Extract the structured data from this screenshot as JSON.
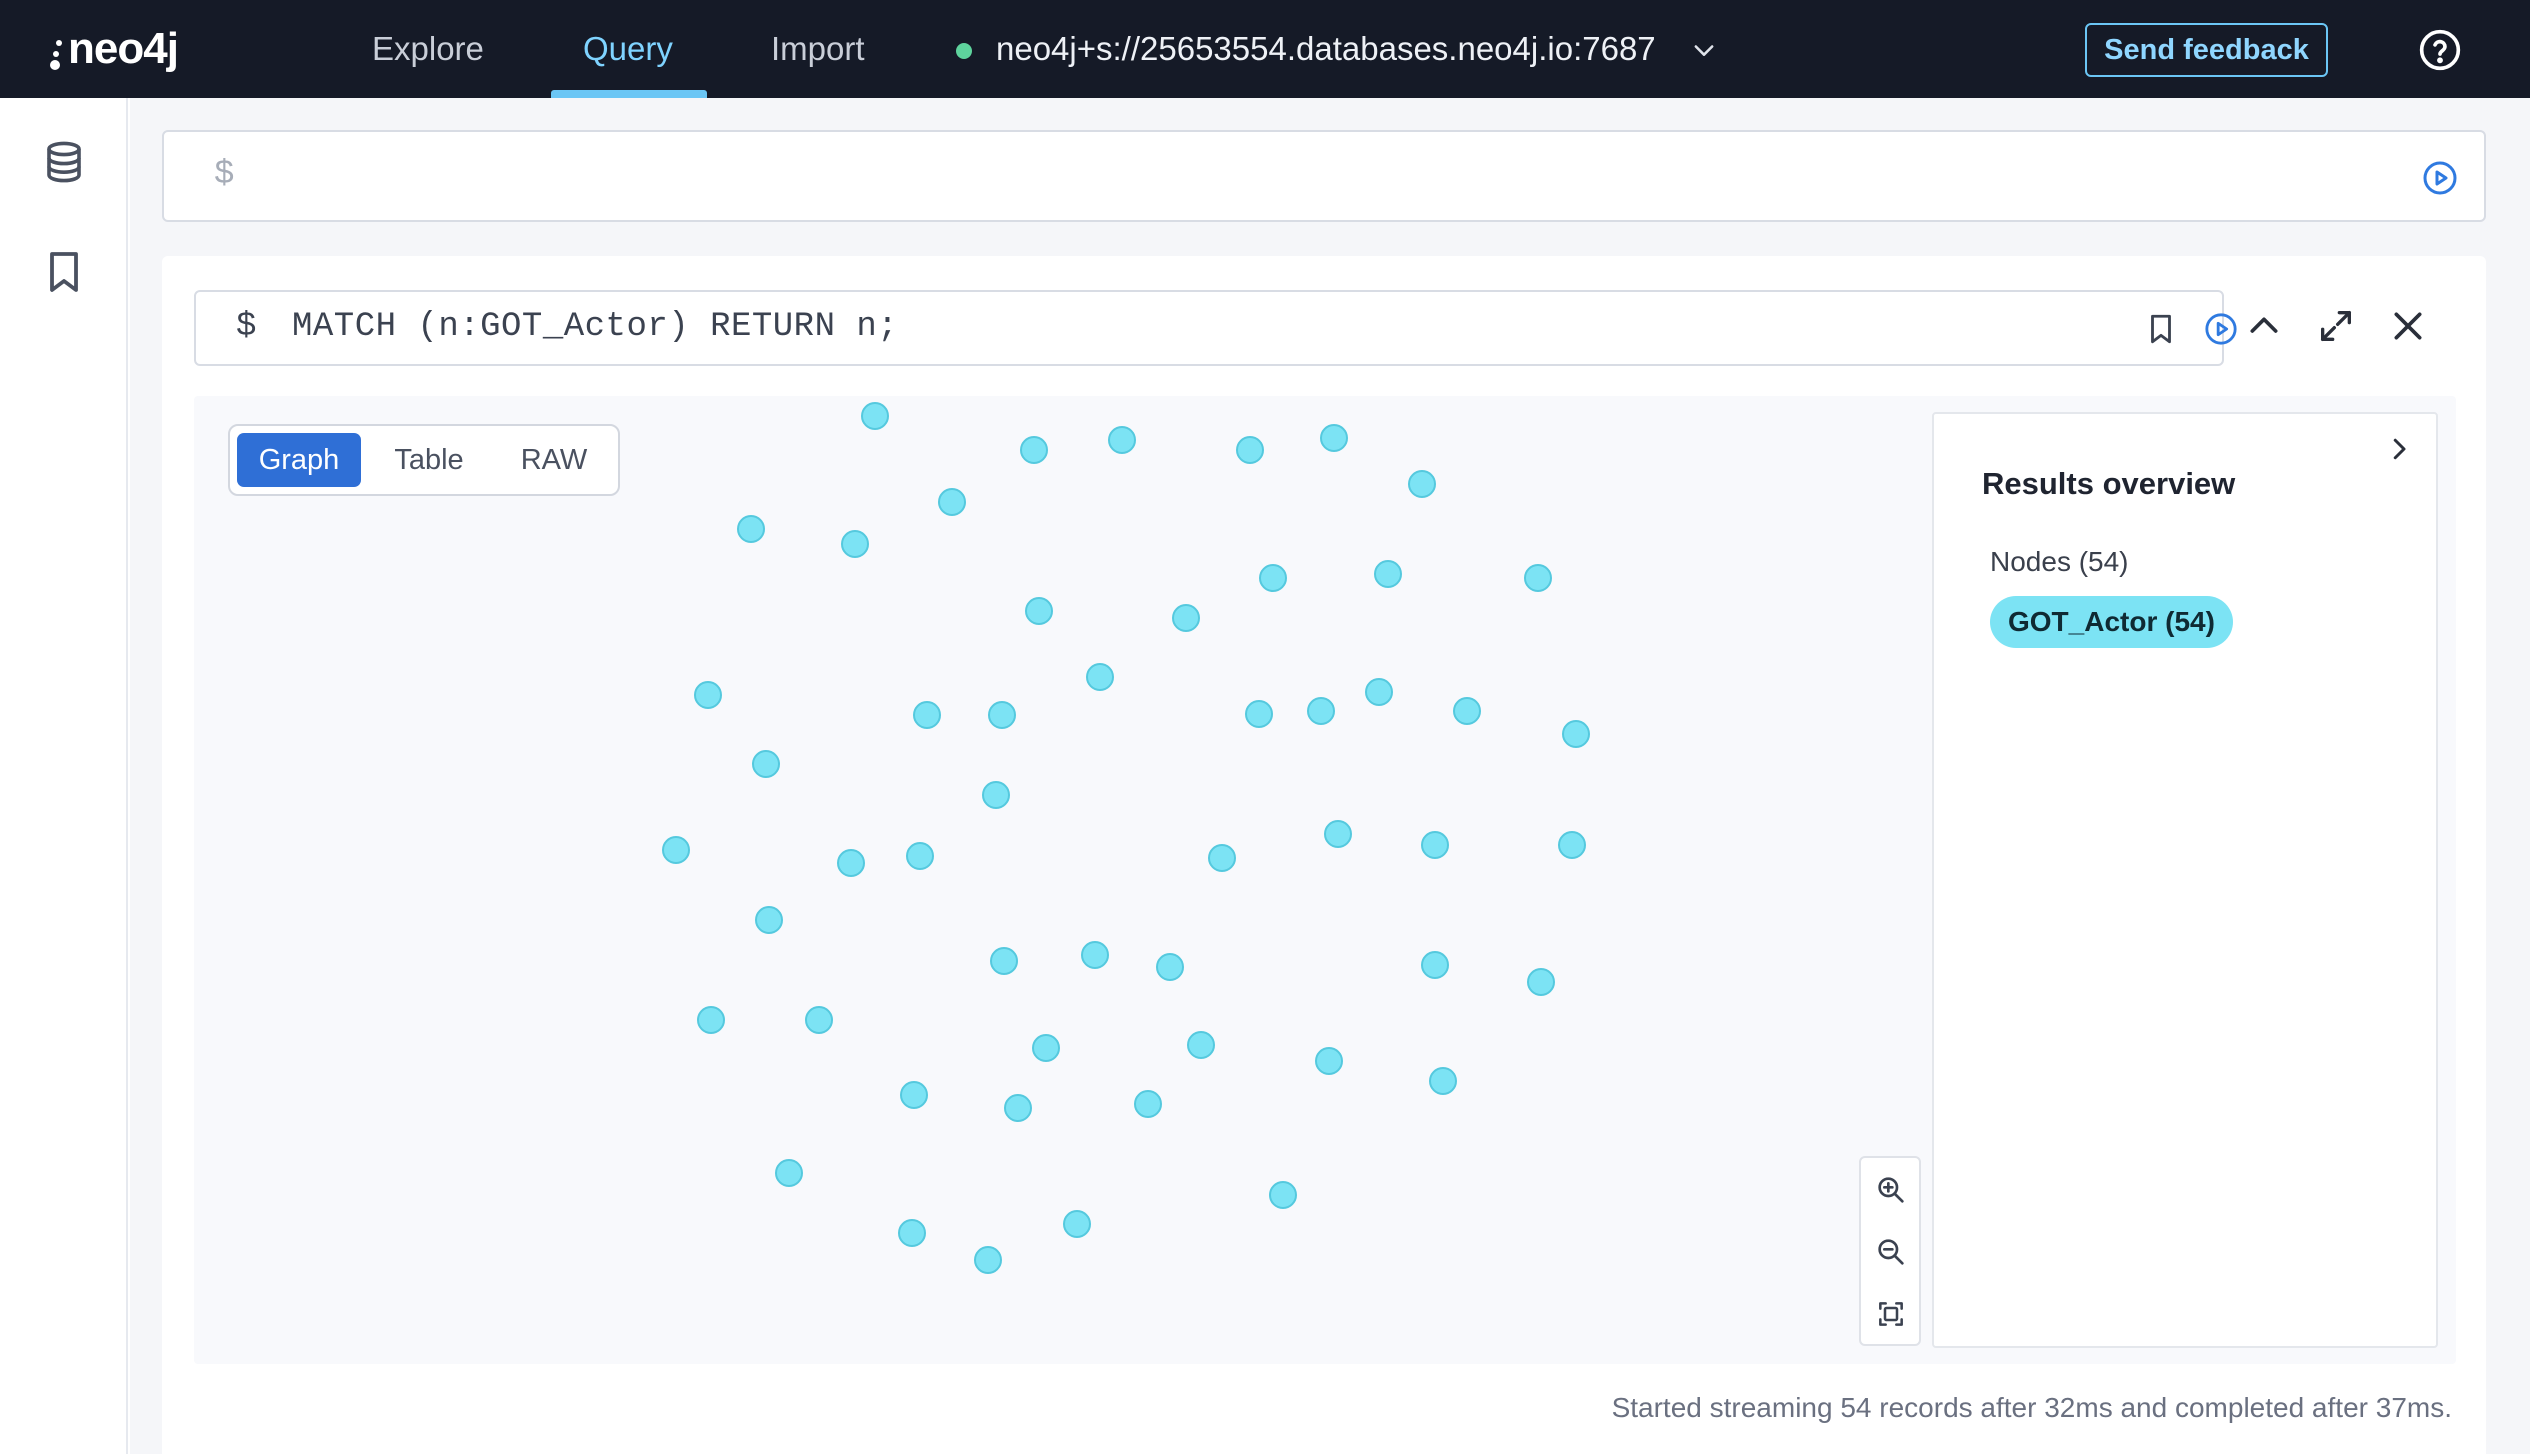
{
  "app": {
    "logo_text": "neo4j",
    "nav": [
      {
        "label": "Explore"
      },
      {
        "label": "Query",
        "active": true
      },
      {
        "label": "Import"
      }
    ],
    "connection": {
      "url": "neo4j+s://25653554.databases.neo4j.io:7687",
      "status_color": "#5ed39d"
    },
    "feedback_label": "Send feedback",
    "accent_color": "#6bc6f5"
  },
  "sidebar": {
    "items": [
      {
        "icon": "database-icon"
      },
      {
        "icon": "bookmark-icon"
      }
    ]
  },
  "editor": {
    "prompt": "$"
  },
  "result_frame": {
    "prompt": "$",
    "query": "MATCH (n:GOT_Actor) RETURN n;",
    "view_tabs": [
      {
        "label": "Graph",
        "active": true
      },
      {
        "label": "Table"
      },
      {
        "label": "RAW"
      }
    ],
    "graph": {
      "node_color": "#7ce3f4",
      "node_count": 54
    },
    "overview": {
      "title": "Results overview",
      "nodes_label": "Nodes (54)",
      "labels": [
        {
          "text": "GOT_Actor (54)",
          "color": "#7ce3f4"
        }
      ]
    },
    "status": "Started streaming 54 records after 32ms and completed after 37ms."
  }
}
